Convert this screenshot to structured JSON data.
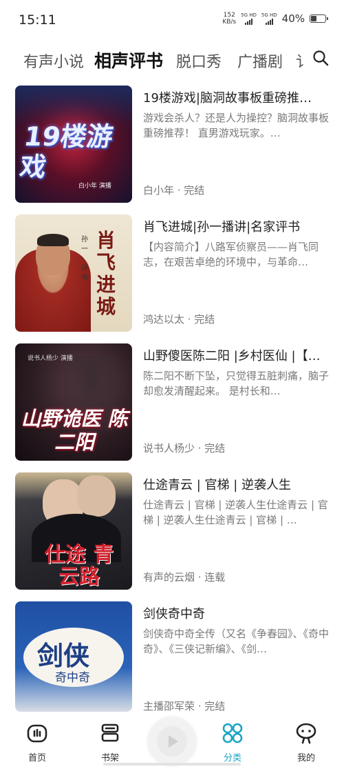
{
  "status_bar": {
    "time": "15:11",
    "net_speed_value": "152",
    "net_speed_unit": "KB/s",
    "signal_1": "5G HD",
    "signal_2": "5G HD",
    "battery": "40%",
    "battery_level": 0.4
  },
  "tabs": [
    {
      "label": "有声小说",
      "active": false
    },
    {
      "label": "相声评书",
      "active": true
    },
    {
      "label": "脱口秀",
      "active": false
    },
    {
      "label": "广播剧",
      "active": false
    },
    {
      "label": "讠",
      "active": false
    }
  ],
  "search_icon": "search-icon",
  "items": [
    {
      "title": "19楼游戏|脑洞故事板重磅推…",
      "desc": "游戏会杀人？还是人为操控？脑洞故事板重磅推荐！ 直男游戏玩家。…",
      "meta": "白小年 · 完结",
      "cover_text": "19楼游戏",
      "cover_sub": "白小年 演播"
    },
    {
      "title": "肖飞进城|孙一播讲|名家评书",
      "desc": "【内容简介】八路军侦察员——肖飞同志，在艰苦卓绝的环境中，与革命…",
      "meta": "鸿达以太 · 完结",
      "cover_text": "肖飞进城",
      "cover_sub": "孙一·评书"
    },
    {
      "title": "山野傻医陈二阳 |乡村医仙 |【…",
      "desc": "陈二阳不断下坠，只觉得五脏刺痛，脑子却愈发清醒起来。 是村长和…",
      "meta": "说书人杨少 · 完结",
      "cover_text": "山野诡医 陈二阳",
      "cover_sub": "说书人杨少 演播"
    },
    {
      "title": "仕途青云 | 官梯 | 逆袭人生",
      "desc": "仕途青云 | 官梯 | 逆袭人生仕途青云 | 官梯 | 逆袭人生仕途青云 | 官梯 | …",
      "meta": "有声的云烟 · 连载",
      "cover_text": "仕途 青云路",
      "cover_sub": ""
    },
    {
      "title": "剑侠奇中奇",
      "desc": "剑侠奇中奇全传（又名《争春园》、《奇中奇》、《三侠记新编》、《剑…",
      "meta": "主播邵军荣 · 完结",
      "cover_text": "剑侠",
      "cover_sub": "奇中奇"
    }
  ],
  "bottom_nav": [
    {
      "label": "首页",
      "icon": "home-icon"
    },
    {
      "label": "书架",
      "icon": "bookshelf-icon"
    },
    {
      "label": "分类",
      "icon": "category-icon",
      "active": true
    },
    {
      "label": "我的",
      "icon": "profile-icon"
    }
  ],
  "colors": {
    "accent": "#1aa6c4",
    "text": "#222222",
    "secondary": "#7a7a7a"
  }
}
